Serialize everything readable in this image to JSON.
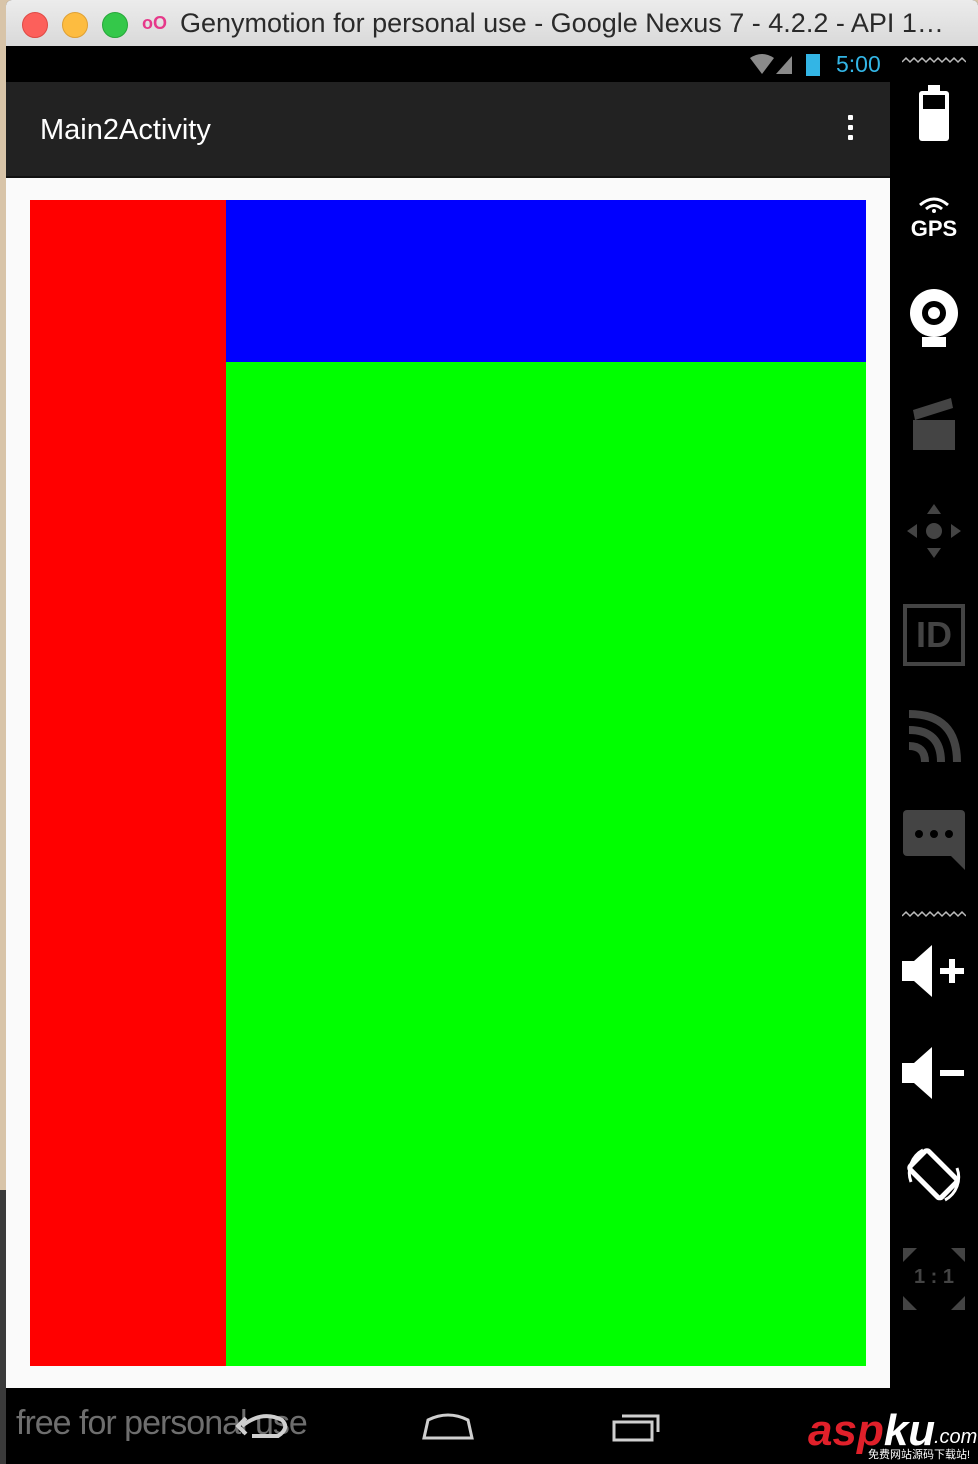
{
  "window": {
    "title": "Genymotion for personal use - Google Nexus 7 - 4.2.2 - API 1…"
  },
  "statusbar": {
    "time": "5:00"
  },
  "actionbar": {
    "title": "Main2Activity"
  },
  "layout_colors": {
    "left": "#ff0000",
    "top_right": "#0000ff",
    "bottom_right": "#00ff00"
  },
  "navbar": {
    "watermark": "free for personal use"
  },
  "sidebar": {
    "gps_label": "GPS",
    "id_label": "ID",
    "ratio_label": "1 : 1"
  },
  "logo": {
    "asp": "asp",
    "ku": "ku",
    "com": ".com",
    "sub": "免费网站源码下载站!"
  }
}
